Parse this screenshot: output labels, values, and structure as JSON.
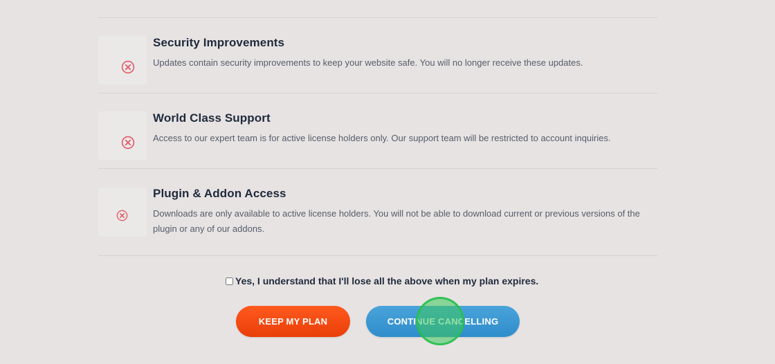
{
  "features": [
    {
      "title": "Security Improvements",
      "description": "Updates contain security improvements to keep your website safe. You will no longer receive these updates.",
      "icon": "x-circle-icon"
    },
    {
      "title": "World Class Support",
      "description": "Access to our expert team is for active license holders only. Our support team will be restricted to account inquiries.",
      "icon": "x-circle-icon"
    },
    {
      "title": "Plugin & Addon Access",
      "description": "Downloads are only available to active license holders. You will not be able to download current or previous versions of the plugin or any of our addons.",
      "icon": "x-circle-icon"
    }
  ],
  "confirm": {
    "label": "Yes, I understand that I'll lose all the above when my plan expires.",
    "checked": false
  },
  "buttons": {
    "keep_label": "KEEP MY PLAN",
    "continue_label": "CONTINUE CANCELLING"
  },
  "colors": {
    "background": "#e7e3e3",
    "x_icon": "#e05a63",
    "keep_button": "#f04a12",
    "continue_button": "#3b97d3",
    "click_marker": "#3cc85a"
  }
}
